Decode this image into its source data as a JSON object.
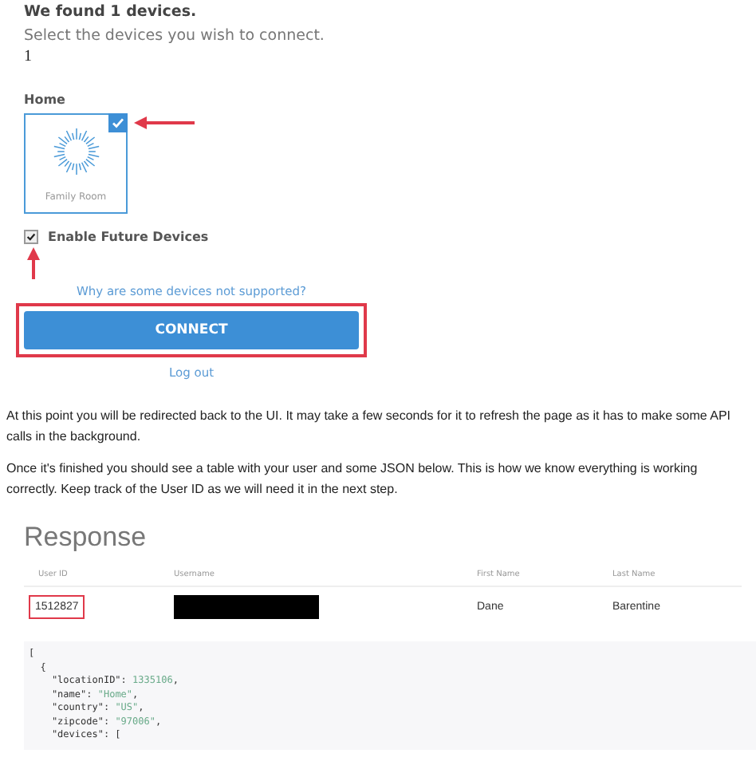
{
  "found_title": "We found 1 devices.",
  "instruction": "Select the devices you wish to connect.",
  "count": "1",
  "group": {
    "label": "Home",
    "devices": [
      {
        "name": "Family Room",
        "selected": true
      }
    ]
  },
  "enable_future": {
    "label": "Enable Future Devices",
    "checked": true
  },
  "help_link": "Why are some devices not supported?",
  "connect_button": {
    "label": "CONNECT",
    "highlighted": true
  },
  "logout_link": "Log out",
  "paragraphs": [
    "At this point you will be redirected back to the UI. It may take a few seconds for it to refresh the page as it has to make some API calls in the background.",
    "Once it's finished you should see a table with your user and some JSON below. This is how we know everything is working correctly. Keep track of the User ID as we will need it in the next step."
  ],
  "response": {
    "title": "Response",
    "columns": [
      "User ID",
      "Username",
      "First Name",
      "Last Name"
    ],
    "row": {
      "user_id": "1512827",
      "user_id_highlighted": true,
      "username_redacted": true,
      "first_name": "Dane",
      "last_name": "Barentine"
    }
  },
  "code_lines": [
    {
      "text": "["
    },
    {
      "text": "  {"
    },
    {
      "text": "    \"locationID\": ",
      "value": "1335106",
      "tail": ","
    },
    {
      "text": "    \"name\": ",
      "value": "\"Home\"",
      "tail": ","
    },
    {
      "text": "    \"country\": ",
      "value": "\"US\"",
      "tail": ","
    },
    {
      "text": "    \"zipcode\": ",
      "value": "\"97006\"",
      "tail": ","
    },
    {
      "text": "    \"devices\": ["
    }
  ]
}
